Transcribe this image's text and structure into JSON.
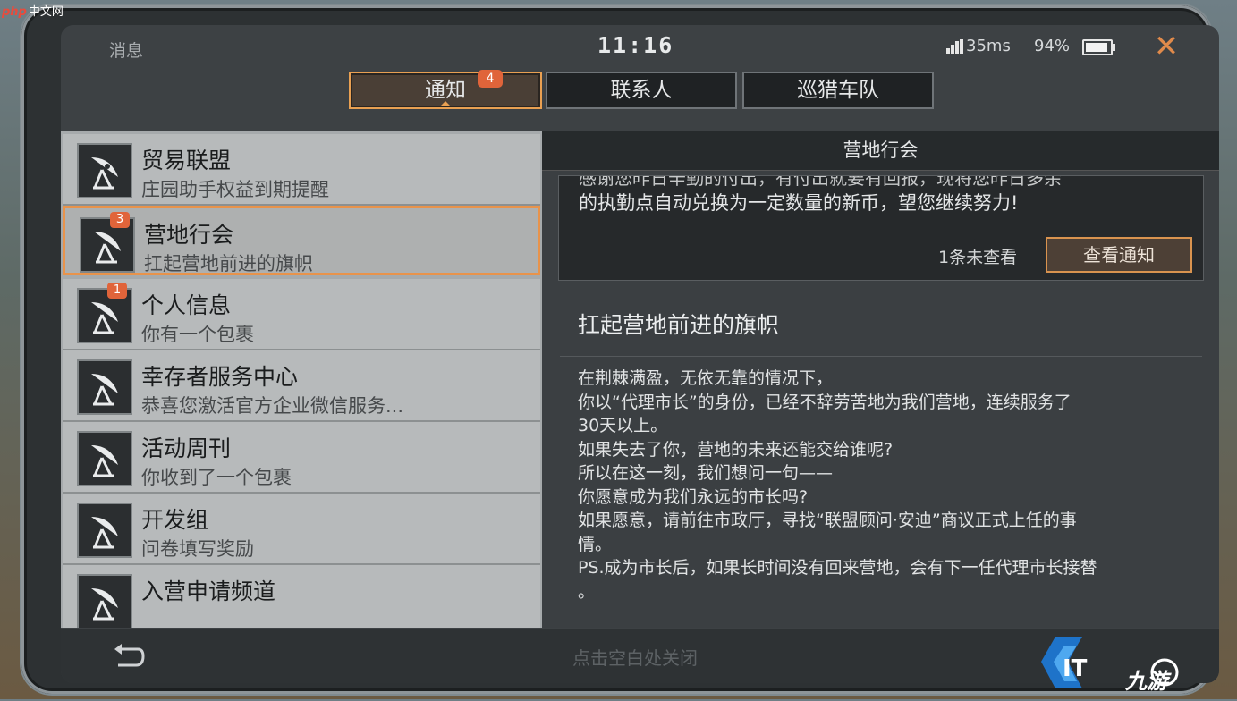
{
  "watermark_top": {
    "brand": "php",
    "site": "中文网"
  },
  "status": {
    "title": "消息",
    "time": "11:16",
    "ping": "35ms",
    "battery": "94%",
    "battery_level": 0.94,
    "close_icon": "close-icon"
  },
  "tabs": [
    {
      "label": "通知",
      "badge": "4",
      "active": true
    },
    {
      "label": "联系人",
      "active": false
    },
    {
      "label": "巡猎车队",
      "active": false
    }
  ],
  "list": [
    {
      "title": "贸易联盟",
      "subtitle": "庄园助手权益到期提醒",
      "badge": ""
    },
    {
      "title": "营地行会",
      "subtitle": "扛起营地前进的旗帜",
      "badge": "3",
      "selected": true
    },
    {
      "title": "个人信息",
      "subtitle": "你有一个包裹",
      "badge": "1"
    },
    {
      "title": "幸存者服务中心",
      "subtitle": "恭喜您激活官方企业微信服务...",
      "badge": ""
    },
    {
      "title": "活动周刊",
      "subtitle": "你收到了一个包裹",
      "badge": ""
    },
    {
      "title": "开发组",
      "subtitle": "问卷填写奖励",
      "badge": ""
    },
    {
      "title": "入营申请频道",
      "subtitle": "",
      "badge": ""
    }
  ],
  "detail": {
    "header": "营地行会",
    "card_preview": "感谢您昨日辛勤的付出，有付出就要有回报，现将您昨日多余",
    "card_text": "的执勤点自动兑换为一定数量的新币，望您继续努力!",
    "unread": "1条未查看",
    "view_button": "查看通知",
    "title": "扛起营地前进的旗帜",
    "body": [
      "在荆棘满盈，无依无靠的情况下，",
      "你以“代理市长”的身份，已经不辞劳苦地为我们营地，连续服务了",
      "30天以上。",
      "如果失去了你，营地的未来还能交给谁呢?",
      "所以在这一刻，我们想问一句——",
      "你愿意成为我们永远的市长吗?",
      "如果愿意，请前往市政厅，寻找“联盟顾问·安迪”商议正式上任的事",
      "情。",
      "PS.成为市长后，如果长时间没有回来营地，会有下一任代理市长接替",
      "。"
    ]
  },
  "bottom": {
    "hint": "点击空白处关闭",
    "back_icon": "back-arrow-icon"
  },
  "watermark_bottom": {
    "text": "九游"
  },
  "colors": {
    "accent": "#e9a052",
    "badge": "#e0643a"
  }
}
